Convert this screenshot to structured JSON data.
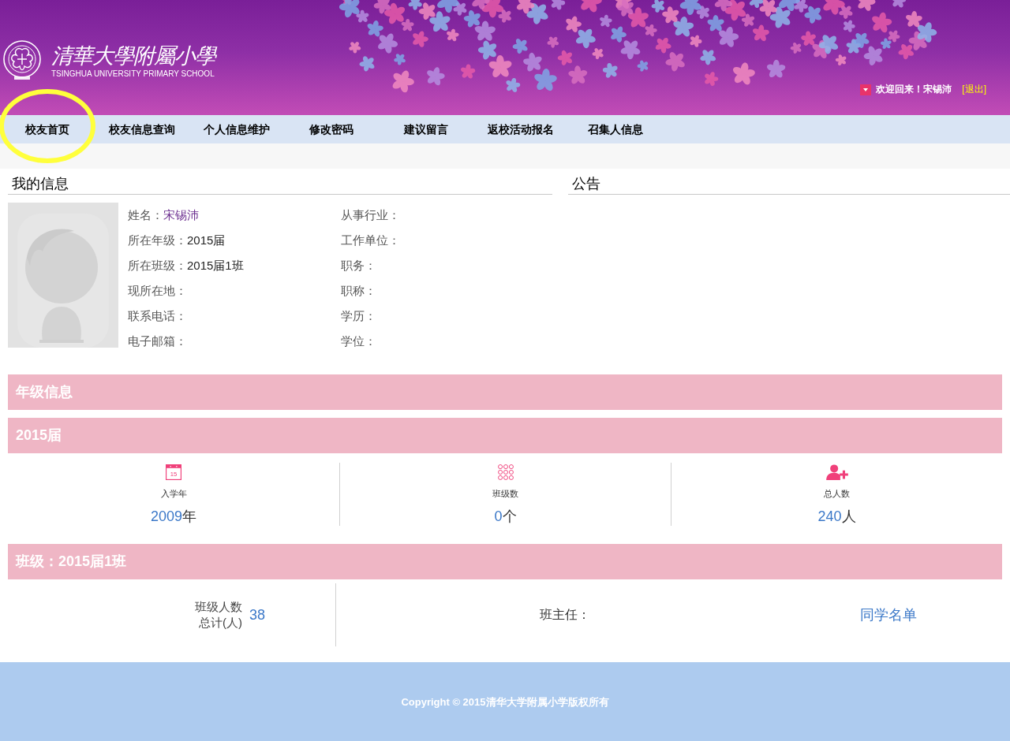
{
  "header": {
    "school_name": "清華大學附屬小學",
    "school_name_en": "TSINGHUA UNIVERSITY PRIMARY SCHOOL",
    "welcome": "欢迎回来！宋锡沛",
    "logout": "[退出]"
  },
  "nav": [
    {
      "label": "校友首页",
      "highlighted": true
    },
    {
      "label": "校友信息查询",
      "highlighted": false
    },
    {
      "label": "个人信息维护",
      "highlighted": false
    },
    {
      "label": "修改密码",
      "highlighted": false
    },
    {
      "label": "建议留言",
      "highlighted": false
    },
    {
      "label": "返校活动报名",
      "highlighted": false
    },
    {
      "label": "召集人信息",
      "highlighted": false
    }
  ],
  "my_info": {
    "title": "我的信息",
    "left_column": [
      {
        "label": "姓名：",
        "value": "宋锡沛",
        "kind": "link"
      },
      {
        "label": "所在年级：",
        "value": "2015届",
        "kind": "text"
      },
      {
        "label": "所在班级：",
        "value": "2015届1班",
        "kind": "text"
      },
      {
        "label": "现所在地："
      },
      {
        "label": "联系电话："
      },
      {
        "label": "电子邮箱："
      }
    ],
    "right_column": [
      {
        "label": "从事行业："
      },
      {
        "label": "工作单位："
      },
      {
        "label": "职务："
      },
      {
        "label": "职称："
      },
      {
        "label": "学历："
      },
      {
        "label": "学位："
      }
    ]
  },
  "notice": {
    "title": "公告"
  },
  "grade_info": {
    "title": "年级信息",
    "grade": "2015届",
    "stats": [
      {
        "kind": "calendar",
        "icon_text": "15",
        "label": "入学年",
        "value": "2009",
        "unit": "年"
      },
      {
        "kind": "grid",
        "label": "班级数",
        "value": "0",
        "unit": "个"
      },
      {
        "kind": "person-add",
        "label": "总人数",
        "value": "240",
        "unit": "人"
      }
    ]
  },
  "class_info": {
    "title": "班级：2015届1班",
    "count_label": "班级人数总计(人)",
    "count": "38",
    "teacher_label": "班主任：",
    "roster_link": "同学名单"
  },
  "footer": {
    "copyright": "Copyright © 2015清华大学附属小学版权所有"
  }
}
